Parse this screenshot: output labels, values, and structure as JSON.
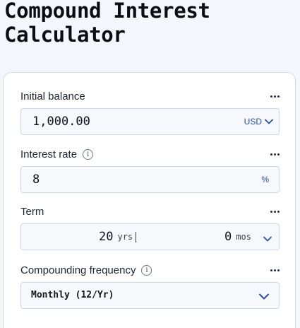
{
  "page": {
    "title_line1": "Compound Interest",
    "title_line2": "Calculator"
  },
  "fields": {
    "initial_balance": {
      "label": "Initial balance",
      "value": "1,000.00",
      "currency": "USD"
    },
    "interest_rate": {
      "label": "Interest rate",
      "value": "8",
      "unit": "%"
    },
    "term": {
      "label": "Term",
      "years": "20",
      "years_unit": "yrs",
      "months": "0",
      "months_unit": "mos"
    },
    "compounding_frequency": {
      "label": "Compounding frequency",
      "selected": "Monthly (12/Yr)"
    }
  },
  "colors": {
    "accent": "#2a4fa8",
    "background": "#f3f6fb",
    "card": "#ffffff",
    "input_bg": "#f6f8fb"
  },
  "icons": {
    "more": "more-horizontal-icon",
    "info": "info-icon",
    "chevron": "chevron-down-icon"
  }
}
